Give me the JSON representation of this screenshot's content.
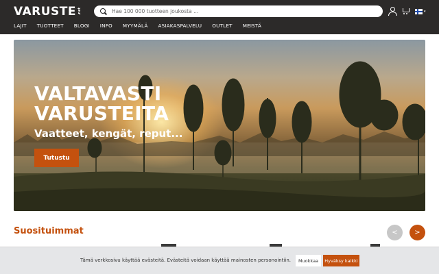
{
  "header": {
    "logo_text": "VARUSTE",
    "logo_suffix": ".net",
    "search_placeholder": "Hae 100 000 tuotteen joukosta ...",
    "nav": [
      "LAJIT",
      "TUOTTEET",
      "BLOGI",
      "INFO",
      "MYYMÄLÄ",
      "ASIAKASPALVELU",
      "OUTLET",
      "MEISTÄ"
    ],
    "icons": [
      "user-icon",
      "cart-icon",
      "finnish-flag-icon"
    ]
  },
  "hero": {
    "title_line1": "VALTAVASTI",
    "title_line2": "VARUSTEITA",
    "subtitle": "Vaatteet, kengät, reput...",
    "button_label": "Tutustu"
  },
  "popular": {
    "title": "Suosituimmat",
    "prev_label": "<",
    "next_label": ">"
  },
  "cookie": {
    "text": "Tämä verkkosivu käyttää evästeitä. Evästeitä voidaan käyttää mainosten personointiin.",
    "edit_label": "Muokkaa",
    "accept_label": "Hyväksy kaikki"
  },
  "colors": {
    "accent": "#c4510e",
    "header_bg": "#2c2a29",
    "cookie_bg": "#e5e6e8"
  }
}
